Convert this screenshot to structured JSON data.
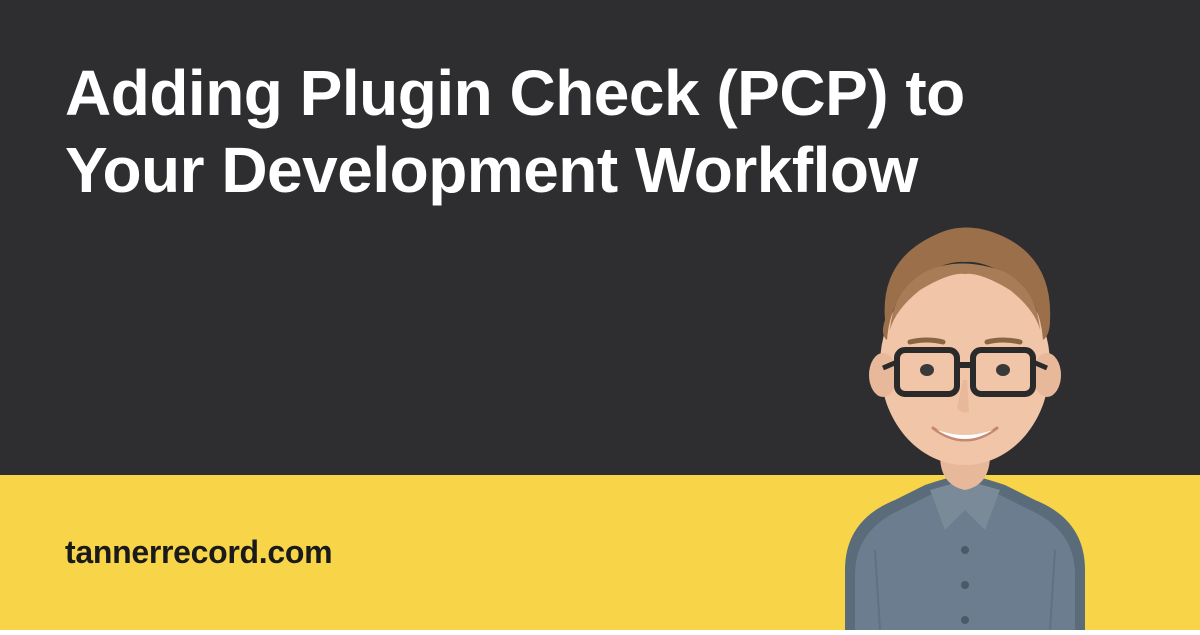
{
  "title": "Adding Plugin Check (PCP) to Your Development Workflow",
  "site_url": "tannerrecord.com",
  "colors": {
    "dark_bg": "#2e2e30",
    "accent": "#f8d548",
    "title_text": "#ffffff",
    "url_text": "#1a1a1a"
  }
}
